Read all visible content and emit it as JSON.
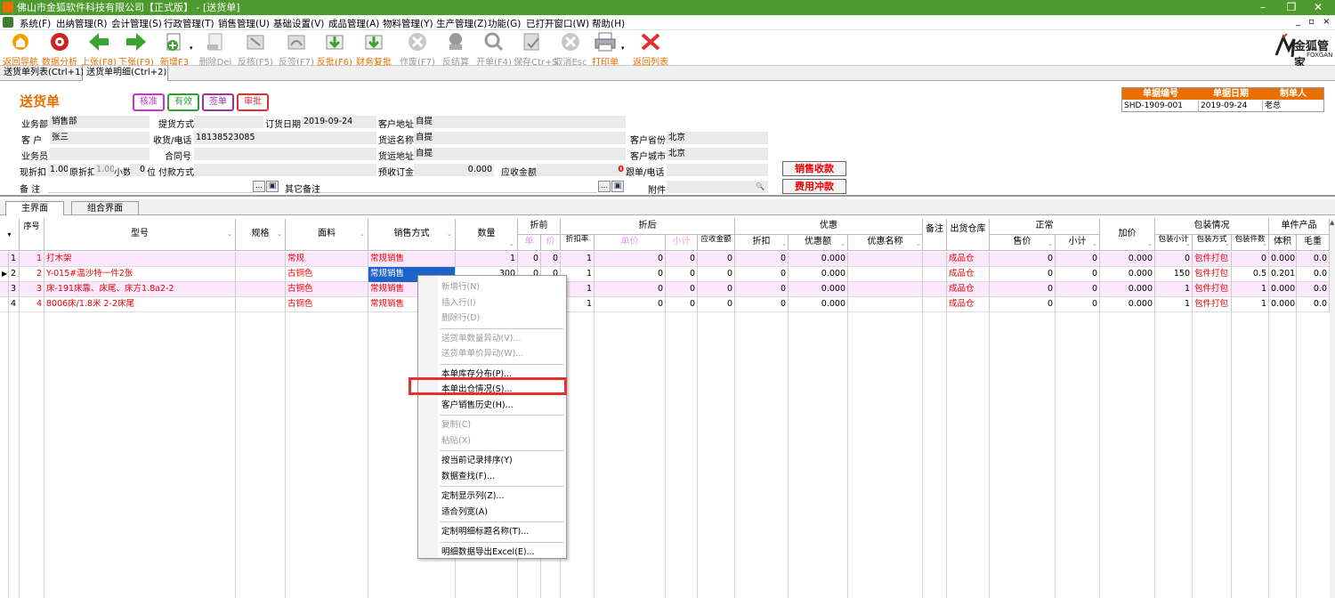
{
  "window": {
    "title": "佛山市金狐软件科技有限公司【正式版】 - [送货单]",
    "min": "–",
    "max": "❐",
    "close": "✕"
  },
  "menu": [
    "系统(F)",
    "出纳管理(R)",
    "会计管理(S)",
    "行政管理(T)",
    "销售管理(U)",
    "基础设置(V)",
    "成品管理(A)",
    "物料管理(Y)",
    "生产管理(Z)",
    "功能(G)",
    "已打开窗口(W)",
    "帮助(H)"
  ],
  "menu_right": "_ ▫ ×",
  "toolbar": [
    {
      "label": "返回导航",
      "icon": "home-icon",
      "color": "#e86f00",
      "state": "orange"
    },
    {
      "label": "数据分析",
      "icon": "analysis-icon",
      "color": "#d02020",
      "state": "orange"
    },
    {
      "label": "上张(F8)",
      "icon": "left-arrow-icon",
      "color": "#3aa52c",
      "state": "orange"
    },
    {
      "label": "下张(F9)",
      "icon": "right-arrow-icon",
      "color": "#3aa52c",
      "state": "orange"
    },
    {
      "label": "新增F3",
      "icon": "new-doc-icon",
      "color": "#3aa52c",
      "state": "orange"
    },
    {
      "label": "删除Del",
      "icon": "delete-doc-icon",
      "color": "#aaaaaa",
      "state": "gray"
    },
    {
      "label": "反核(F5)",
      "icon": "unaudit-icon",
      "color": "#aaaaaa",
      "state": "gray"
    },
    {
      "label": "反签(F7)",
      "icon": "unsign-icon",
      "color": "#aaaaaa",
      "state": "gray"
    },
    {
      "label": "反批(F6)",
      "icon": "unapprove-icon",
      "color": "#3aa52c",
      "state": "orange"
    },
    {
      "label": "财务复批",
      "icon": "finance-approve-icon",
      "color": "#3aa52c",
      "state": "orange"
    },
    {
      "label": "作废(F7)",
      "icon": "void-icon",
      "color": "#aaaaaa",
      "state": "gray"
    },
    {
      "label": "反结算",
      "icon": "unsettle-icon",
      "color": "#aaaaaa",
      "state": "gray"
    },
    {
      "label": "开单(F4)",
      "icon": "open-icon",
      "color": "#aaaaaa",
      "state": "gray"
    },
    {
      "label": "保存Ctr+S",
      "icon": "save-icon",
      "color": "#aaaaaa",
      "state": "gray"
    },
    {
      "label": "取消Esc",
      "icon": "cancel-icon",
      "color": "#aaaaaa",
      "state": "gray"
    },
    {
      "label": "打印单",
      "icon": "print-icon",
      "color": "#777777",
      "state": "orange"
    },
    {
      "label": "返回列表",
      "icon": "close-red-icon",
      "color": "#e03030",
      "state": "orange"
    }
  ],
  "logo": {
    "text": "金狐管家",
    "sub": "FOXGAN"
  },
  "tabs": [
    "送货单列表(Ctrl+1)",
    "送货单明细(Ctrl+2)"
  ],
  "form": {
    "title": "送货单",
    "stamps": [
      {
        "label": "核准",
        "color": "#d030d0"
      },
      {
        "label": "有效",
        "color": "#30a030"
      },
      {
        "label": "签单",
        "color": "#a030a0"
      },
      {
        "label": "审批",
        "color": "#e03030"
      }
    ],
    "labels": {
      "dept": "业务部",
      "customer": "客  户",
      "salesman": "业务员",
      "cur_discount": "现折扣",
      "orig_discount": "原折扣",
      "decimals": "小数",
      "decimals_unit": "位",
      "remark": "备  注",
      "pickup": "提货方式",
      "phone": "收货/电话",
      "contract": "合同号",
      "payment": "付款方式",
      "order_date": "订货日期",
      "address": "客户地址",
      "ship_name": "货运名称",
      "ship_addr": "货运地址",
      "prepaid": "预收订金",
      "receivable": "应收金额",
      "province": "客户省份",
      "city": "客户城市",
      "follow_phone": "跟单/电话",
      "other_remark": "其它备注",
      "attachment": "附件"
    },
    "values": {
      "dept": "销售部",
      "customer": "张三",
      "cur_discount": "1.00",
      "orig_discount": "1.00",
      "decimals": "0",
      "phone": "18138523085",
      "order_date": "2019-09-24",
      "address": "自提",
      "ship_name": "自提",
      "ship_addr": "自提",
      "prepaid": "0.000",
      "receivable": "0",
      "province": "北京",
      "city": "北京"
    },
    "buttons": {
      "sales_receipt": "销售收款",
      "expense_offset": "费用冲款",
      "ellipsis": "…",
      "save_glyph": "▣",
      "search_glyph": "🔍"
    }
  },
  "infotable": {
    "headers": [
      "单据编号",
      "单据日期",
      "制单人"
    ],
    "values": [
      "SHD-1909-001",
      "2019-09-24",
      "老总"
    ]
  },
  "subtabs": [
    "主界面",
    "组合界面"
  ],
  "grid": {
    "headers": {
      "seq": "序号",
      "model": "型号",
      "spec": "规格",
      "fabric": "面料",
      "sale_mode": "销售方式",
      "qty": "数量",
      "before_disc": "折前",
      "after_disc": "折后",
      "promo": "优惠",
      "remark": "备注",
      "warehouse": "出货仓库",
      "normal": "正常",
      "markup": "加价",
      "packing": "包装情况",
      "unit_product": "单件产品",
      "unit": "单",
      "price": "价",
      "disc_rate": "折扣率",
      "unit_price": "单价",
      "subtotal": "小计",
      "should_receive": "应收金额",
      "discount": "折扣",
      "promo_amount": "优惠额",
      "promo_name": "优惠名称",
      "sell_price": "售价",
      "normal_subtotal": "小计",
      "pack_subtotal": "包装小计",
      "pack_mode": "包装方式",
      "pack_count": "包装件数",
      "volume": "体积",
      "gross_weight": "毛重"
    },
    "rows": [
      {
        "n": "1",
        "seq": "1",
        "model": "打木架",
        "spec": "",
        "fabric": "常规",
        "mode": "常规销售",
        "qty": "1",
        "p1": "0",
        "p2": "0",
        "rate": "1",
        "up": "0",
        "sub": "0",
        "recv": "0",
        "disc": "0",
        "pamt": "0.000",
        "pname": "",
        "rmk": "",
        "wh": "成品仓",
        "sell": "0",
        "nsub": "0",
        "markup": "0.000",
        "psub": "0",
        "pmode": "包件打包",
        "pcnt": "0",
        "vol": "0.000",
        "gw": "0.0"
      },
      {
        "n": "2",
        "seq": "2",
        "model": "Y-015#温沙特一件2张",
        "spec": "",
        "fabric": "古铜色",
        "mode": "常规销售",
        "qty": "300",
        "p1": "0",
        "p2": "0",
        "rate": "1",
        "up": "0",
        "sub": "0",
        "recv": "0",
        "disc": "0",
        "pamt": "0.000",
        "pname": "",
        "rmk": "",
        "wh": "成品仓",
        "sell": "0",
        "nsub": "0",
        "markup": "0.000",
        "psub": "150",
        "pmode": "包件打包",
        "pcnt": "0.5",
        "vol": "0.201",
        "gw": "0.0"
      },
      {
        "n": "3",
        "seq": "3",
        "model": "床-191床靠、床尾、床方1.8a2-2",
        "spec": "",
        "fabric": "古铜色",
        "mode": "常规销售",
        "qty": "",
        "p1": "",
        "p2": "",
        "rate": "1",
        "up": "0",
        "sub": "0",
        "recv": "0",
        "disc": "0",
        "pamt": "0.000",
        "pname": "",
        "rmk": "",
        "wh": "成品仓",
        "sell": "0",
        "nsub": "0",
        "markup": "0.000",
        "psub": "1",
        "pmode": "包件打包",
        "pcnt": "1",
        "vol": "0.000",
        "gw": "0.0"
      },
      {
        "n": "4",
        "seq": "4",
        "model": "8006床/1.8米 2-2床尾",
        "spec": "",
        "fabric": "古铜色",
        "mode": "常规销售",
        "qty": "",
        "p1": "",
        "p2": "",
        "rate": "1",
        "up": "0",
        "sub": "0",
        "recv": "0",
        "disc": "0",
        "pamt": "0.000",
        "pname": "",
        "rmk": "",
        "wh": "成品仓",
        "sell": "0",
        "nsub": "0",
        "markup": "0.000",
        "psub": "1",
        "pmode": "包件打包",
        "pcnt": "1",
        "vol": "0.000",
        "gw": "0.0"
      }
    ]
  },
  "context_menu": [
    {
      "label": "新增行(N)",
      "enabled": false
    },
    {
      "label": "插入行(I)",
      "enabled": false
    },
    {
      "label": "删除行(D)",
      "enabled": false
    },
    {
      "sep": true
    },
    {
      "label": "送货单数量异动(V)...",
      "enabled": false
    },
    {
      "label": "送货单单价异动(W)...",
      "enabled": false
    },
    {
      "sep": true
    },
    {
      "label": "本单库存分布(P)...",
      "enabled": true
    },
    {
      "label": "本单出仓情况(S)...",
      "enabled": true,
      "highlighted": true
    },
    {
      "label": "客户销售历史(H)...",
      "enabled": true
    },
    {
      "sep": true
    },
    {
      "label": "复制(C)",
      "enabled": false
    },
    {
      "label": "粘贴(X)",
      "enabled": false
    },
    {
      "sep": true
    },
    {
      "label": "按当前记录排序(Y)",
      "enabled": true
    },
    {
      "label": "数据查找(F)...",
      "enabled": true
    },
    {
      "sep": true
    },
    {
      "label": "定制显示列(Z)...",
      "enabled": true
    },
    {
      "label": "适合列宽(A)",
      "enabled": true
    },
    {
      "sep": true
    },
    {
      "label": "定制明细标题名称(T)...",
      "enabled": true
    },
    {
      "sep": true
    },
    {
      "label": "明细数据导出Excel(E)...",
      "enabled": true
    }
  ]
}
